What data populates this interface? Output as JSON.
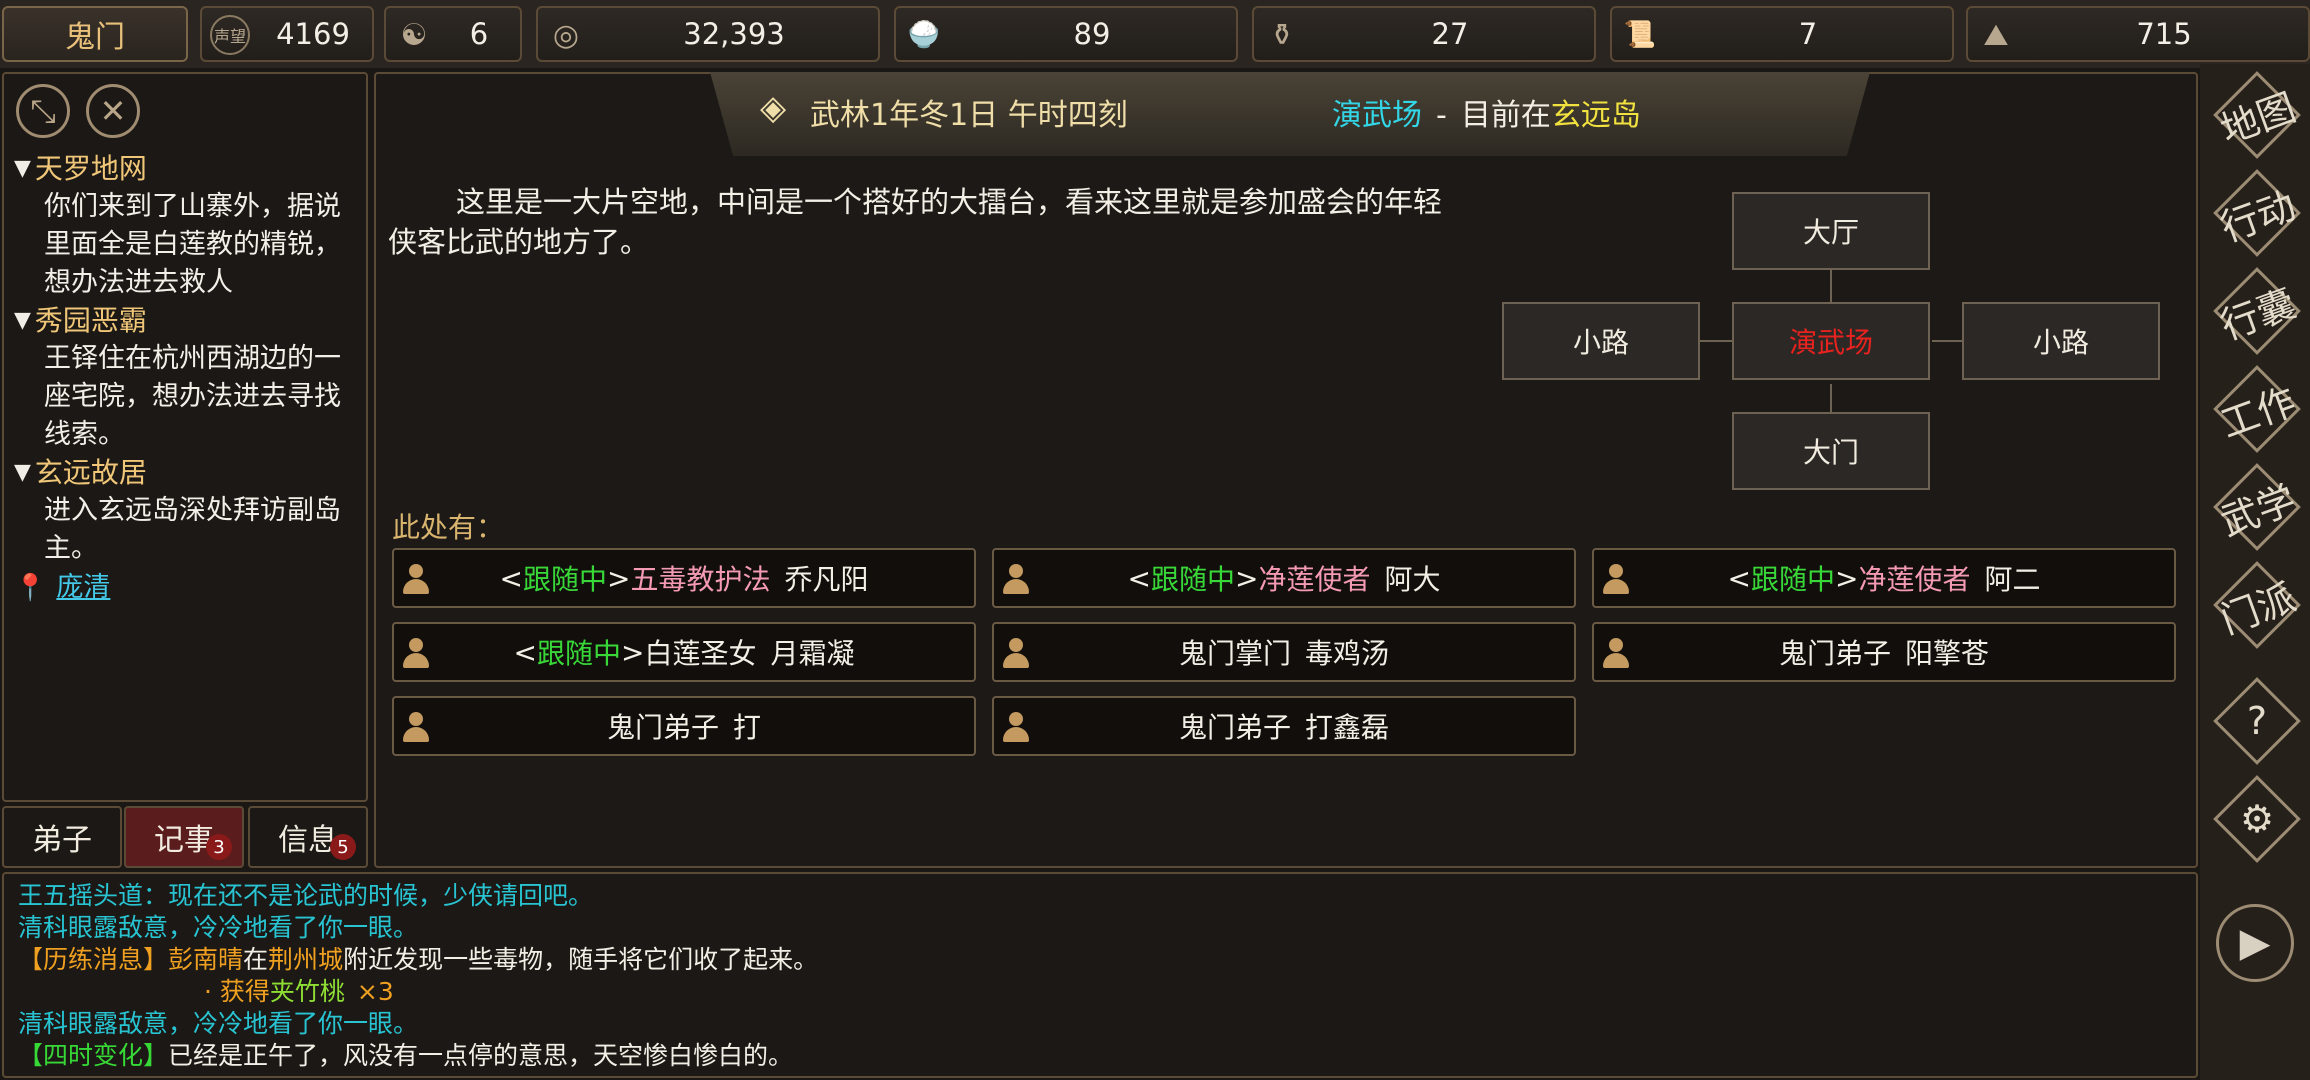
{
  "top_bar": {
    "sect": "鬼门",
    "stats": [
      {
        "icon": "reputation-icon",
        "glyph": "声望",
        "value": "4169"
      },
      {
        "icon": "yin-yang-icon",
        "glyph": "☯",
        "value": "6"
      },
      {
        "icon": "coin-icon",
        "glyph": "◎",
        "value": "32,393"
      },
      {
        "icon": "food-bowl-icon",
        "glyph": "🍚",
        "value": "89"
      },
      {
        "icon": "gourd-icon",
        "glyph": "⚱",
        "value": "27"
      },
      {
        "icon": "scroll-icon",
        "glyph": "📜",
        "value": "7"
      },
      {
        "icon": "ore-icon",
        "glyph": "⛰",
        "value": "715"
      }
    ]
  },
  "quest_panel": {
    "collapse_icon": "⤡",
    "close_icon": "✕",
    "quests": [
      {
        "title": "天罗地网",
        "desc": "你们来到了山寨外，据说里面全是白莲教的精锐，想办法进去救人"
      },
      {
        "title": "秀园恶霸",
        "desc": "王铎住在杭州西湖边的一座宅院，想办法进去寻找线索。"
      },
      {
        "title": "玄远故居",
        "desc": "进入玄远岛深处拜访副岛主。"
      }
    ],
    "npc_link": "庞清"
  },
  "tabs": [
    {
      "label": "弟子",
      "badge": ""
    },
    {
      "label": "记事",
      "badge": "3"
    },
    {
      "label": "信息",
      "badge": "5"
    }
  ],
  "banner": {
    "date": "武林1年冬1日 午时四刻",
    "room": "演武场",
    "dash": "-",
    "prefix": "目前在",
    "island": "玄远岛"
  },
  "room_desc": "这里是一大片空地，中间是一个搭好的大擂台，看来这里就是参加盛会的年轻侠客比武的地方了。",
  "map": {
    "north": "大厅",
    "west": "小路",
    "center": "演武场",
    "east": "小路",
    "south": "大门"
  },
  "here_label": "此处有：",
  "npcs": [
    {
      "follow": true,
      "title": "五毒教护法",
      "name": "乔凡阳"
    },
    {
      "follow": true,
      "title": "净莲使者",
      "name": "阿大"
    },
    {
      "follow": true,
      "title": "净莲使者",
      "name": "阿二"
    },
    {
      "follow": true,
      "title": "白莲圣女",
      "name": "月霜凝"
    },
    {
      "follow": false,
      "title": "鬼门掌门",
      "name": "毒鸡汤"
    },
    {
      "follow": false,
      "title": "鬼门弟子",
      "name": "阳擎苍"
    },
    {
      "follow": false,
      "title": "鬼门弟子",
      "name": "打"
    },
    {
      "follow": false,
      "title": "鬼门弟子",
      "name": "打鑫磊"
    }
  ],
  "follow_label": "跟随中",
  "right_nav": [
    {
      "icon": "map-icon",
      "label": "地图"
    },
    {
      "icon": "action-icon",
      "label": "行动"
    },
    {
      "icon": "bag-icon",
      "label": "行囊"
    },
    {
      "icon": "work-icon",
      "label": "工作"
    },
    {
      "icon": "martial-icon",
      "label": "武学"
    },
    {
      "icon": "sect-icon",
      "label": "门派"
    }
  ],
  "help_glyph": "?",
  "settings_glyph": "⚙",
  "play_glyph": "▶",
  "log": {
    "line1": "王五摇头道：现在还不是论武的时候，少侠请回吧。",
    "line2": "清科眼露敌意，冷冷地看了你一眼。",
    "line3_tag": "【历练消息】",
    "line3_person": "彭南晴",
    "line3_at": "在",
    "line3_city": "荆州城",
    "line3_rest": "附近发现一些毒物，随手将它们收了起来。",
    "line4_prefix": "· 获得",
    "line4_item": "夹竹桃",
    "line4_count": "×3",
    "line5": "清科眼露敌意，冷冷地看了你一眼。",
    "line6_tag": "【四时变化】",
    "line6_rest": "已经是正午了，风没有一点停的意思，天空惨白惨白的。"
  }
}
